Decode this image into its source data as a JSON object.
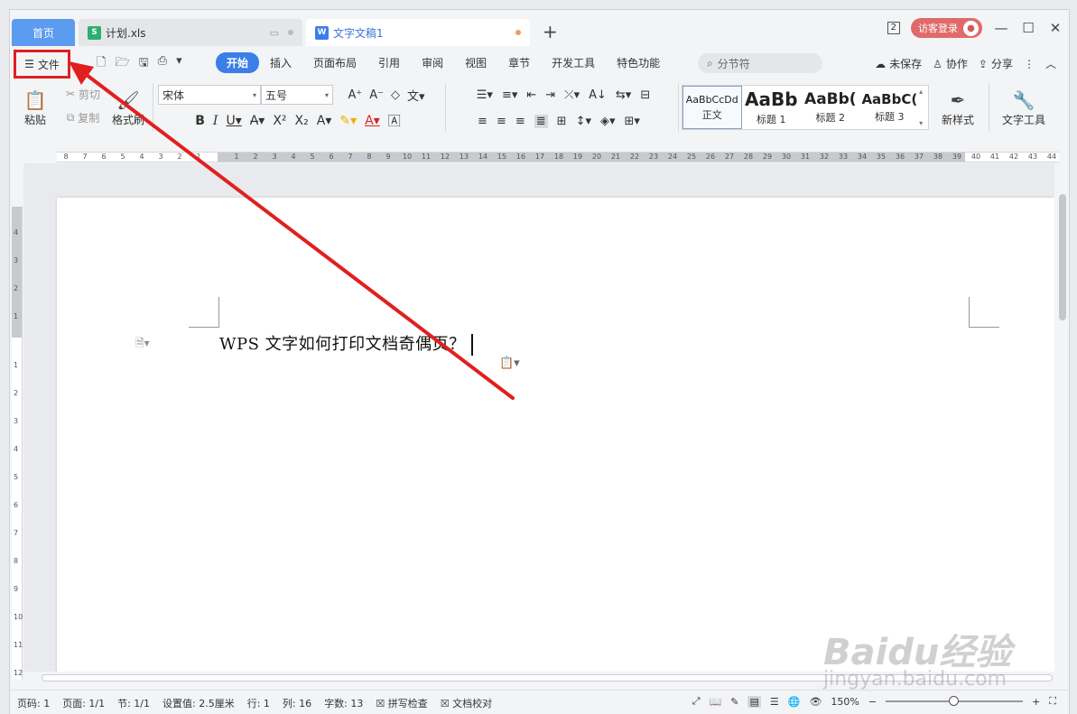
{
  "titlebar": {
    "tabs": [
      {
        "label": "首页"
      },
      {
        "label": "计划.xls"
      },
      {
        "label": "文字文稿1"
      }
    ],
    "add_tab": "+",
    "window_badge": "2",
    "login": "访客登录",
    "minimize": "—",
    "maximize": "☐",
    "close": "✕"
  },
  "menubar": {
    "file": "文件",
    "items": [
      "开始",
      "插入",
      "页面布局",
      "引用",
      "审阅",
      "视图",
      "章节",
      "开发工具",
      "特色功能"
    ],
    "search_placeholder": "分节符",
    "unsaved": "未保存",
    "collab": "协作",
    "share": "分享"
  },
  "ribbon": {
    "paste": "粘贴",
    "cut": "剪切",
    "copy": "复制",
    "format_painter": "格式刷",
    "font_name": "宋体",
    "font_size": "五号",
    "styles": [
      {
        "preview": "AaBbCcDd",
        "name": "正文"
      },
      {
        "preview": "AaBb",
        "name": "标题 1"
      },
      {
        "preview": "AaBb(",
        "name": "标题 2"
      },
      {
        "preview": "AaBbC(",
        "name": "标题 3"
      }
    ],
    "new_style": "新样式",
    "text_tools": "文字工具"
  },
  "ruler": {
    "left_ticks": [
      "8",
      "7",
      "6",
      "5",
      "4",
      "3",
      "2",
      "1"
    ],
    "right_ticks": [
      "1",
      "2",
      "3",
      "4",
      "5",
      "6",
      "7",
      "8",
      "9",
      "10",
      "11",
      "12",
      "13",
      "14",
      "15",
      "16",
      "17",
      "18",
      "19",
      "20",
      "21",
      "22",
      "23",
      "24",
      "25",
      "26",
      "27",
      "28",
      "29",
      "30",
      "31",
      "32",
      "33",
      "34",
      "35",
      "36",
      "37",
      "38",
      "39",
      "40",
      "41",
      "42",
      "43",
      "44"
    ],
    "v_top_ticks": [
      "4",
      "3",
      "2",
      "1"
    ],
    "v_bottom_ticks": [
      "1",
      "2",
      "3",
      "4",
      "5",
      "6",
      "7",
      "8",
      "9",
      "10",
      "11",
      "12"
    ]
  },
  "document": {
    "text": "WPS 文字如何打印文档奇偶页？"
  },
  "statusbar": {
    "page_code": "页码: 1",
    "pages": "页面: 1/1",
    "section": "节: 1/1",
    "setting": "设置值: 2.5厘米",
    "row": "行: 1",
    "col": "列: 16",
    "words": "字数: 13",
    "spell": "拼写检查",
    "proof": "文档校对",
    "zoom": "150%"
  },
  "watermark": {
    "line1": "Baidu经验",
    "line2": "jingyan.baidu.com"
  },
  "colors": {
    "accent": "#3b7ee8",
    "annotation": "#e02020",
    "home_tab": "#5b9bf0"
  }
}
